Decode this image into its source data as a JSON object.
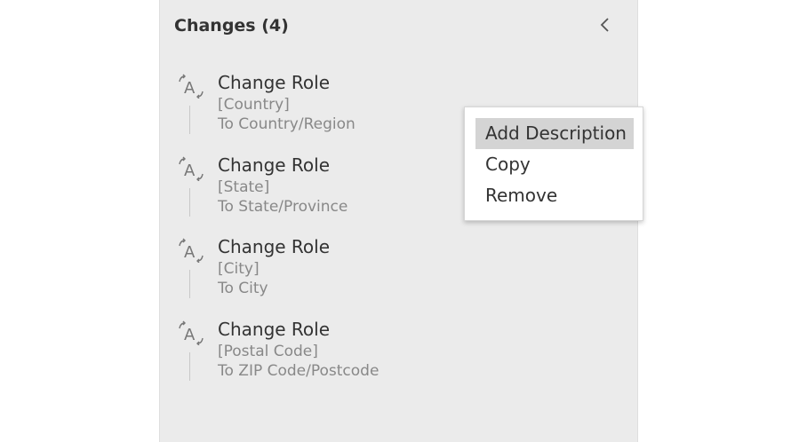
{
  "panel": {
    "title": "Changes (4)",
    "collapse_icon": "chevron-left-icon"
  },
  "changes": [
    {
      "icon": "change-role-icon",
      "name": "Change Role",
      "field": "[Country]",
      "target": "To Country/Region"
    },
    {
      "icon": "change-role-icon",
      "name": "Change Role",
      "field": "[State]",
      "target": "To State/Province"
    },
    {
      "icon": "change-role-icon",
      "name": "Change Role",
      "field": "[City]",
      "target": "To City"
    },
    {
      "icon": "change-role-icon",
      "name": "Change Role",
      "field": "[Postal Code]",
      "target": "To ZIP Code/Postcode"
    }
  ],
  "context_menu": {
    "items": [
      {
        "label": "Add Description",
        "highlighted": true
      },
      {
        "label": "Copy",
        "highlighted": false
      },
      {
        "label": "Remove",
        "highlighted": false
      }
    ]
  },
  "colors": {
    "panel_bg": "#ebebeb",
    "text_primary": "#333333",
    "text_secondary": "#888888",
    "menu_highlight": "#d4d4d4"
  }
}
